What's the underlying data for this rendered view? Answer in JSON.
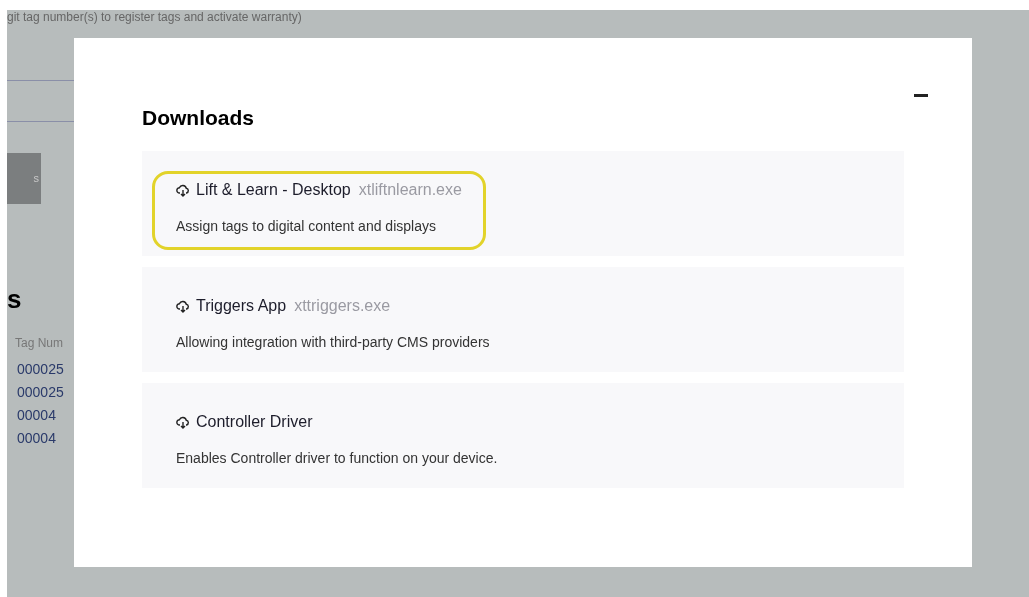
{
  "background": {
    "instruction_text": "git tag number(s) to register tags and activate warranty)",
    "button_label": "s",
    "heading": "s",
    "table": {
      "column_header": "Tag Num",
      "rows": [
        "000025",
        "000025",
        "00004",
        "00004"
      ]
    }
  },
  "modal": {
    "title": "Downloads",
    "items": [
      {
        "name": "Lift & Learn - Desktop",
        "file": "xtliftnlearn.exe",
        "description": "Assign tags to digital content and displays",
        "highlighted": true
      },
      {
        "name": "Triggers App",
        "file": "xttriggers.exe",
        "description": "Allowing integration with third-party CMS providers",
        "highlighted": false
      },
      {
        "name": "Controller Driver",
        "description": "Enables Controller driver to function on your device.",
        "highlighted": false
      }
    ]
  }
}
